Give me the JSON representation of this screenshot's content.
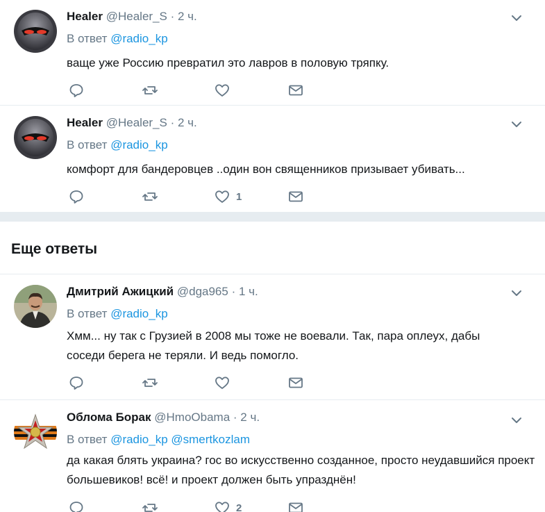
{
  "tweets": [
    {
      "name": "Healer",
      "handle": "@Healer_S",
      "dot": "·",
      "time": "2 ч.",
      "reply_prefix": "В ответ",
      "mentions": [
        "@radio_kp"
      ],
      "text": "ваще уже Россию превратил это лавров в половую тряпку.",
      "like_count": "",
      "avatar_icon": "robot-helmet-avatar"
    },
    {
      "name": "Healer",
      "handle": "@Healer_S",
      "dot": "·",
      "time": "2 ч.",
      "reply_prefix": "В ответ",
      "mentions": [
        "@radio_kp"
      ],
      "text": "комфорт для бандеровцев ..один вон священников призывает убивать...",
      "like_count": "1",
      "avatar_icon": "robot-helmet-avatar"
    },
    {
      "name": "Дмитрий Ажицкий",
      "handle": "@dga965",
      "dot": "·",
      "time": "1 ч.",
      "reply_prefix": "В ответ",
      "mentions": [
        "@radio_kp"
      ],
      "text": "Хмм... ну так с Грузией в 2008 мы тоже не воевали. Так, пара оплеух, дабы соседи берега не теряли. И ведь помогло.",
      "like_count": "",
      "avatar_icon": "person-photo-avatar"
    },
    {
      "name": "Облома Борак",
      "handle": "@HmoObama",
      "dot": "·",
      "time": "2 ч.",
      "reply_prefix": "В ответ",
      "mentions": [
        "@radio_kp",
        "@smertkozlam"
      ],
      "text": "да какая блять украина? гос во искусственно созданное, просто неудавшийся проект большевиков! всё! и проект должен быть упразднён!",
      "like_count": "2",
      "avatar_icon": "order-star-avatar"
    }
  ],
  "section": {
    "title": "Еще ответы"
  },
  "colors": {
    "link": "#1b95e0",
    "muted": "#657786",
    "text": "#14171a",
    "divider": "#e6ecf0"
  }
}
